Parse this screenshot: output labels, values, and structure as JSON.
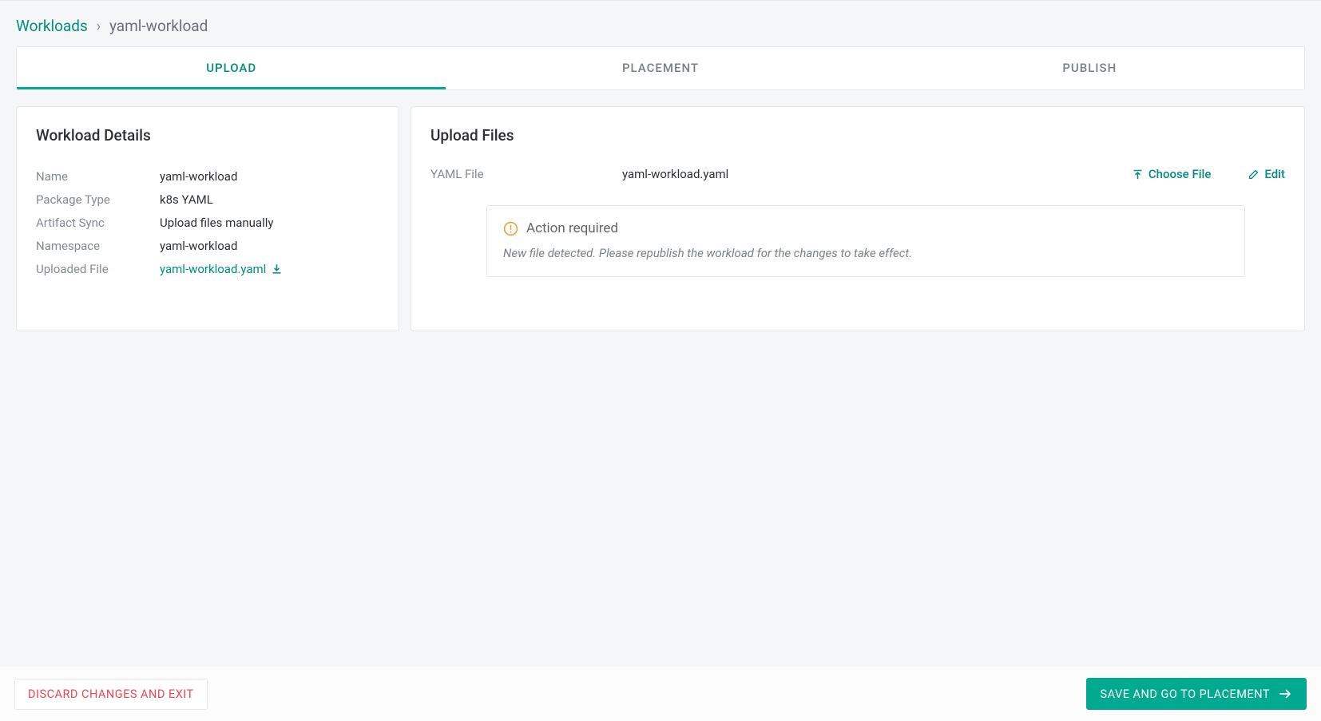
{
  "breadcrumb": {
    "root": "Workloads",
    "current": "yaml-workload"
  },
  "tabs": {
    "upload": "UPLOAD",
    "placement": "PLACEMENT",
    "publish": "PUBLISH"
  },
  "details": {
    "title": "Workload Details",
    "name_label": "Name",
    "name_value": "yaml-workload",
    "package_type_label": "Package Type",
    "package_type_value": "k8s YAML",
    "artifact_sync_label": "Artifact Sync",
    "artifact_sync_value": "Upload files manually",
    "namespace_label": "Namespace",
    "namespace_value": "yaml-workload",
    "uploaded_file_label": "Uploaded File",
    "uploaded_file_value": "yaml-workload.yaml"
  },
  "upload": {
    "title": "Upload Files",
    "yaml_label": "YAML File",
    "yaml_filename": "yaml-workload.yaml",
    "choose_file": "Choose File",
    "edit": "Edit",
    "alert_title": "Action required",
    "alert_message": "New file detected. Please republish the workload for the changes to take effect."
  },
  "footer": {
    "discard": "DISCARD CHANGES AND EXIT",
    "save": "SAVE AND GO TO PLACEMENT"
  }
}
